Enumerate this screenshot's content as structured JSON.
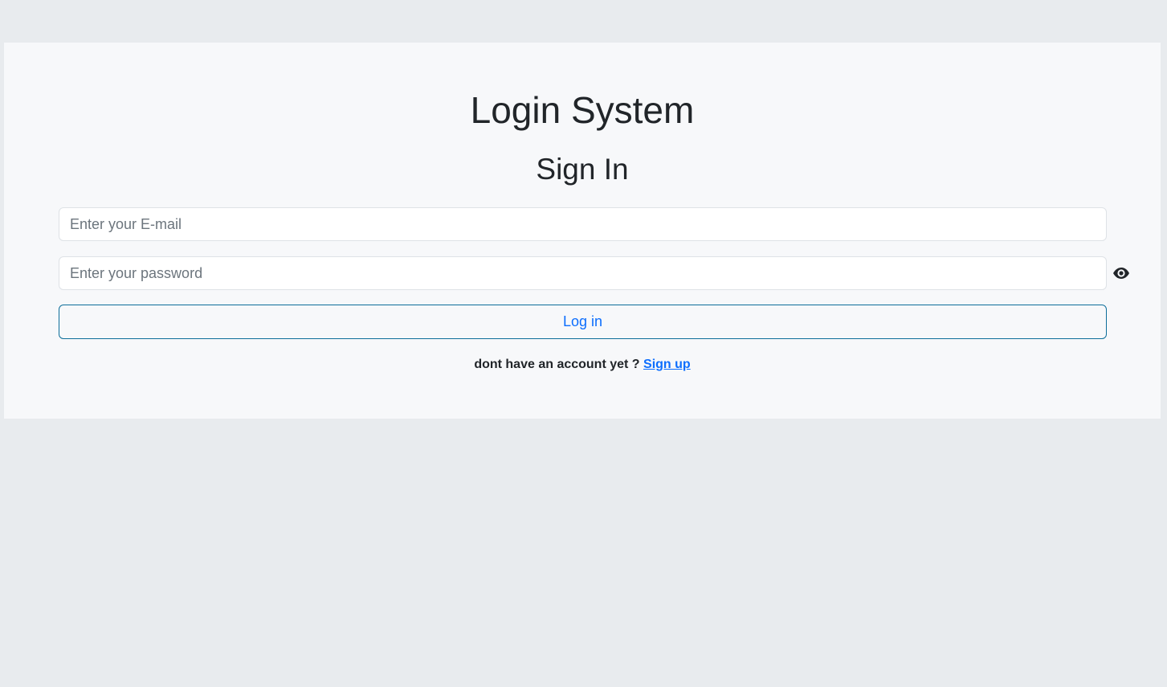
{
  "app": {
    "title": "Login System"
  },
  "form": {
    "title": "Sign In",
    "email": {
      "placeholder": "Enter your E-mail",
      "value": ""
    },
    "password": {
      "placeholder": "Enter your password",
      "value": "",
      "toggle_icon": "eye-icon"
    },
    "login_label": "Log in",
    "signup_prompt": "dont have an account yet ?",
    "signup_link": "Sign up"
  },
  "colors": {
    "page_background": "#e8ebee",
    "panel_background": "#f7f8fa",
    "accent": "#0d6efd",
    "text": "#212529"
  }
}
